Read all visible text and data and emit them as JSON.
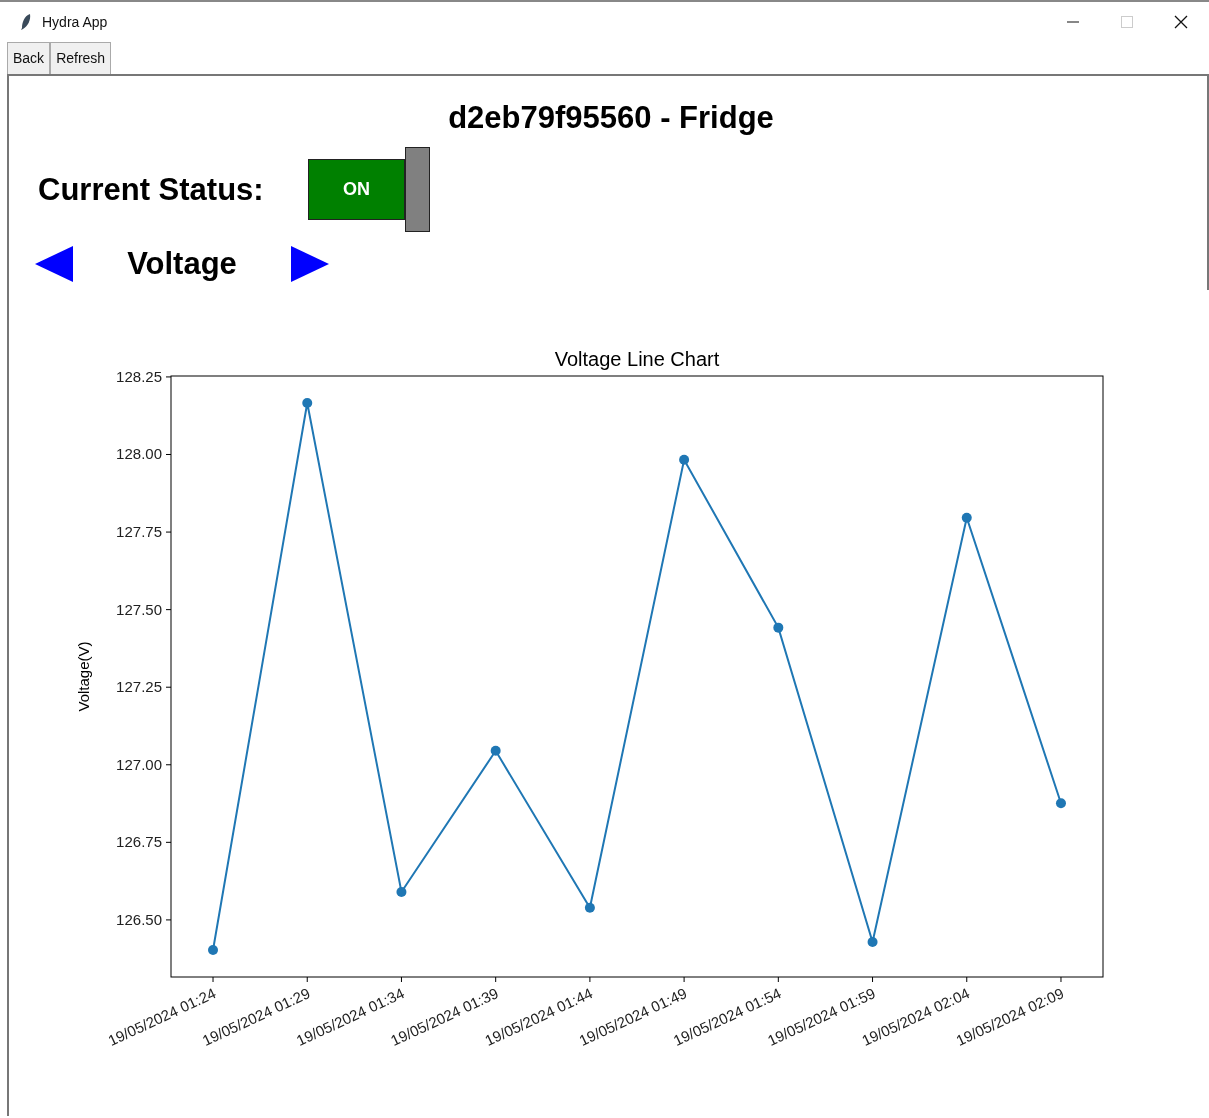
{
  "window": {
    "title": "Hydra App"
  },
  "toolbar": {
    "buttons": [
      "Back",
      "Refresh"
    ]
  },
  "device_title": "d2eb79f95560 - Fridge",
  "status": {
    "label": "Current Status:",
    "toggle_text": "ON",
    "on": true
  },
  "metric": {
    "label": "Voltage"
  },
  "chart": {
    "chart_data": {
      "type": "line",
      "title": "Voltage Line Chart",
      "ylabel": "Voltage(V)",
      "categories": [
        "19/05/2024 01:24",
        "19/05/2024 01:29",
        "19/05/2024 01:34",
        "19/05/2024 01:39",
        "19/05/2024 01:44",
        "19/05/2024 01:49",
        "19/05/2024 01:54",
        "19/05/2024 01:59",
        "19/05/2024 02:04",
        "19/05/2024 02:09"
      ],
      "series": [
        {
          "color": "#1f77b4",
          "marker": "o",
          "values": [
            126.403,
            128.166,
            126.59,
            127.045,
            126.539,
            127.983,
            127.442,
            126.429,
            127.796,
            126.876
          ]
        }
      ],
      "ylim": [
        126.316,
        128.253
      ],
      "yticks": [
        {
          "value": 126.5,
          "label": "126.50"
        },
        {
          "value": 126.75,
          "label": "126.75"
        },
        {
          "value": 127,
          "label": "127.00"
        },
        {
          "value": 127.25,
          "label": "127.25"
        },
        {
          "value": 127.5,
          "label": "127.50"
        },
        {
          "value": 127.75,
          "label": "127.75"
        },
        {
          "value": 128,
          "label": "128.00"
        },
        {
          "value": 128.25,
          "label": "128.25"
        }
      ]
    }
  }
}
